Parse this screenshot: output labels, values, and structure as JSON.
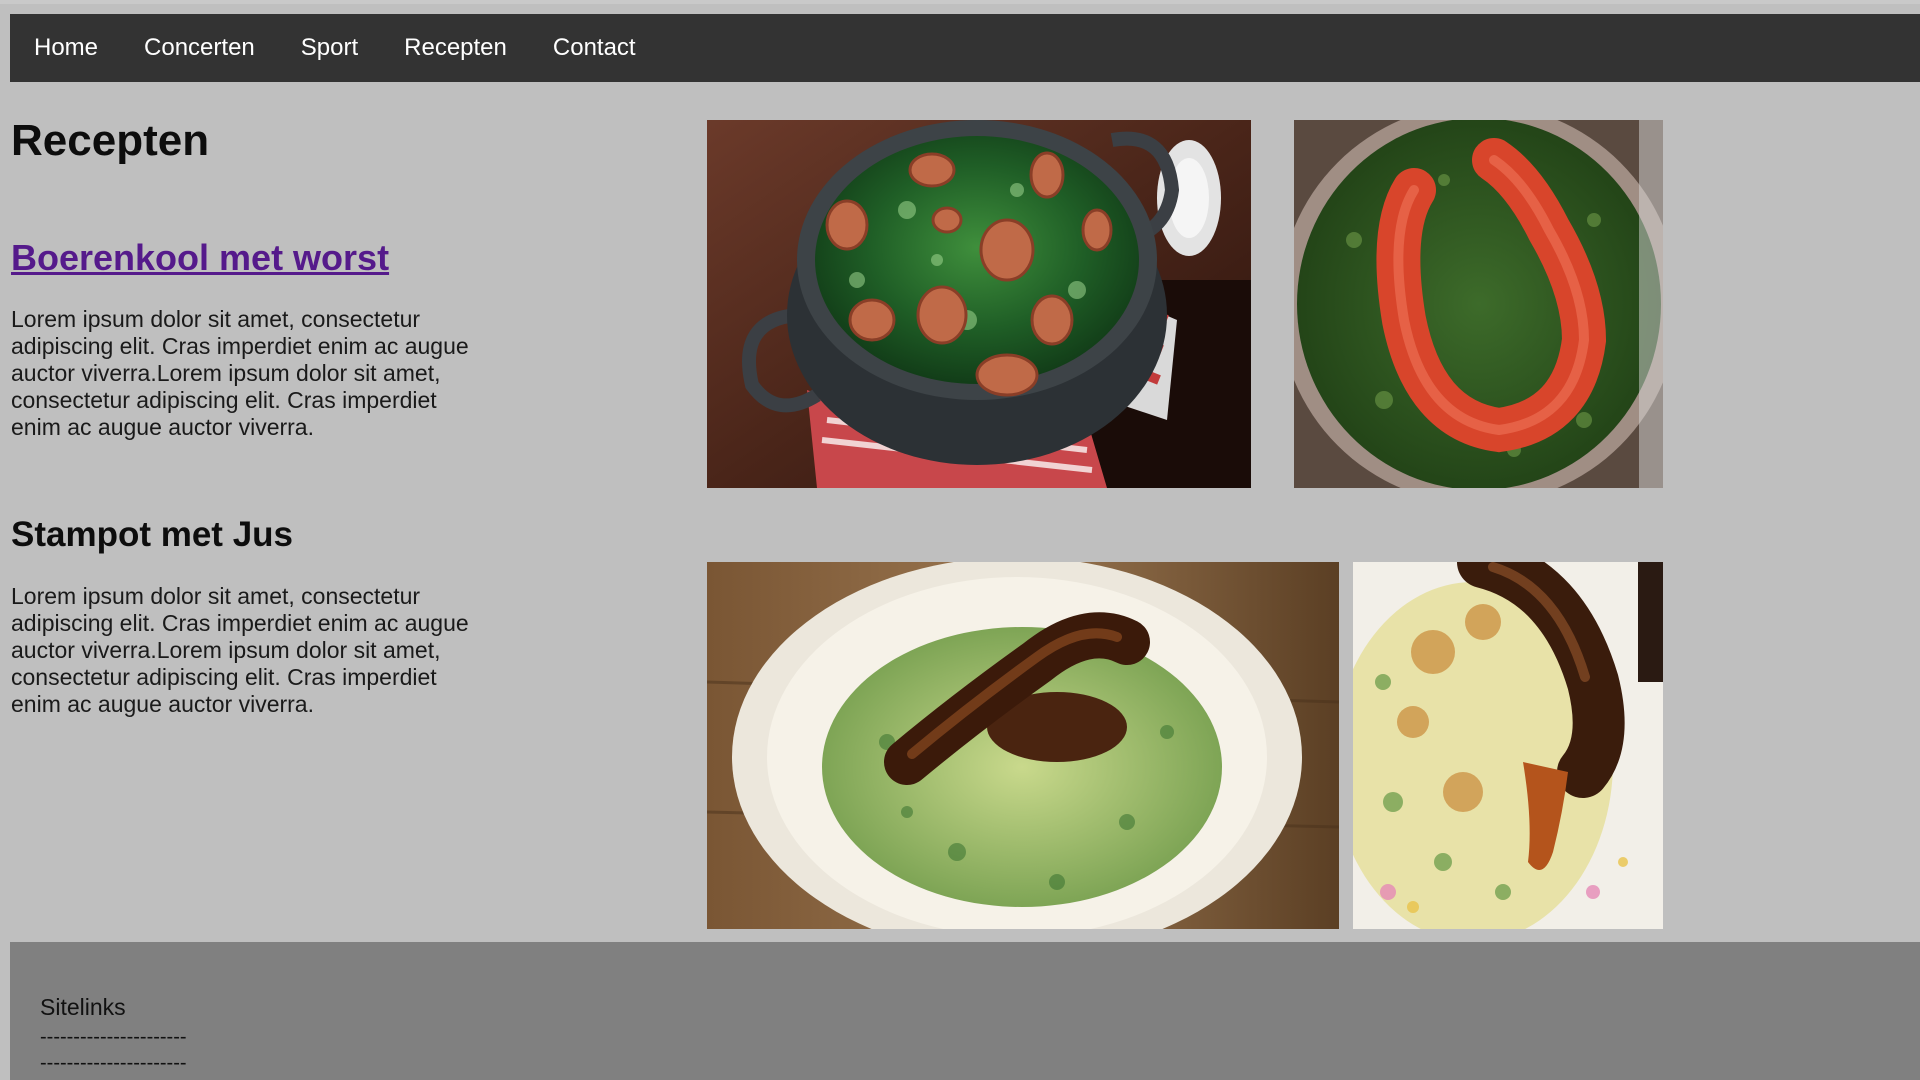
{
  "nav": {
    "items": [
      {
        "label": "Home"
      },
      {
        "label": "Concerten"
      },
      {
        "label": "Sport"
      },
      {
        "label": "Recepten"
      },
      {
        "label": "Contact"
      }
    ]
  },
  "main": {
    "title": "Recepten",
    "recipes": [
      {
        "title": "Boerenkool met worst",
        "text": "Lorem ipsum dolor sit amet, consectetur adipiscing elit. Cras imperdiet enim ac augue auctor viverra.Lorem ipsum dolor sit amet, consectetur adipiscing elit. Cras imperdiet enim ac augue auctor viverra."
      },
      {
        "title": "Stampot met Jus",
        "text": "Lorem ipsum dolor sit amet, consectetur adipiscing elit. Cras imperdiet enim ac augue auctor viverra.Lorem ipsum dolor sit amet, consectetur adipiscing elit. Cras imperdiet enim ac augue auctor viverra."
      }
    ]
  },
  "footer": {
    "title": "Sitelinks",
    "lines": [
      "----------------------",
      "----------------------"
    ]
  },
  "colors": {
    "navbar": "#333333",
    "page_background": "#bfbfbf",
    "footer": "#808080",
    "visited_link": "#551a8b"
  }
}
